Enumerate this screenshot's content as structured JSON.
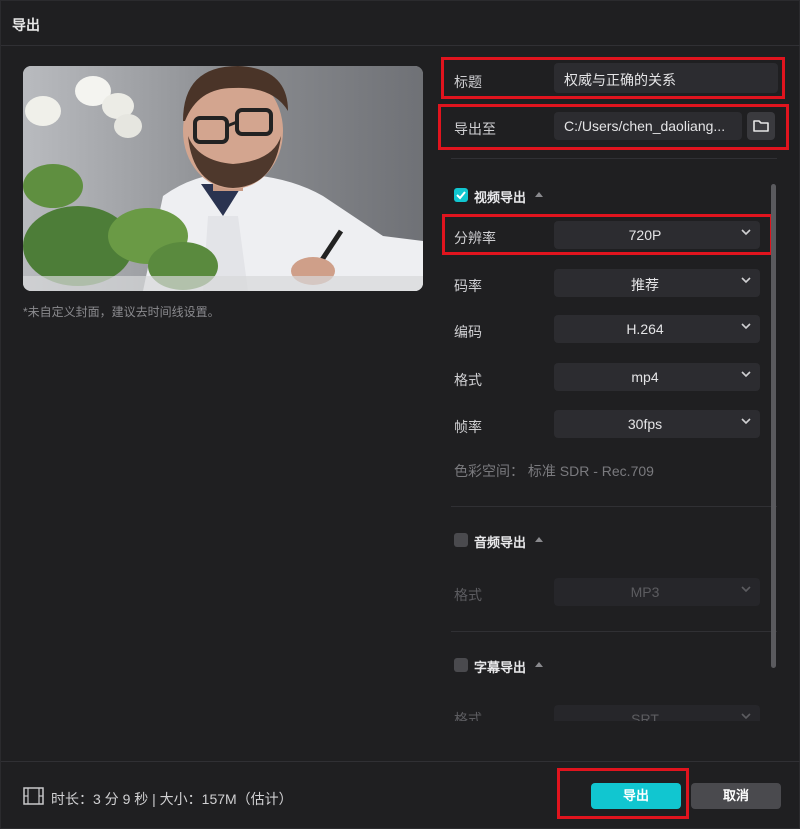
{
  "window": {
    "title": "导出"
  },
  "cover": {
    "hint": "*未自定义封面，建议去时间线设置。"
  },
  "title_field": {
    "label": "标题",
    "value": "权威与正确的关系"
  },
  "export_to": {
    "label": "导出至",
    "value": "C:/Users/chen_daoliang..."
  },
  "video": {
    "header": "视频导出",
    "checked": true,
    "resolution": {
      "label": "分辨率",
      "value": "720P"
    },
    "bitrate": {
      "label": "码率",
      "value": "推荐"
    },
    "codec": {
      "label": "编码",
      "value": "H.264"
    },
    "format": {
      "label": "格式",
      "value": "mp4"
    },
    "framerate": {
      "label": "帧率",
      "value": "30fps"
    },
    "colorspace": "色彩空间： 标准 SDR - Rec.709"
  },
  "audio": {
    "header": "音频导出",
    "checked": false,
    "format": {
      "label": "格式",
      "value": "MP3"
    }
  },
  "subtitle": {
    "header": "字幕导出",
    "checked": false,
    "format": {
      "label": "格式",
      "value": "SRT"
    }
  },
  "footer": {
    "info": "时长：3 分 9 秒 | 大小：157M（估计）",
    "export_label": "导出",
    "cancel_label": "取消"
  },
  "colors": {
    "accent": "#11c6d0",
    "highlight": "#e0141e"
  }
}
